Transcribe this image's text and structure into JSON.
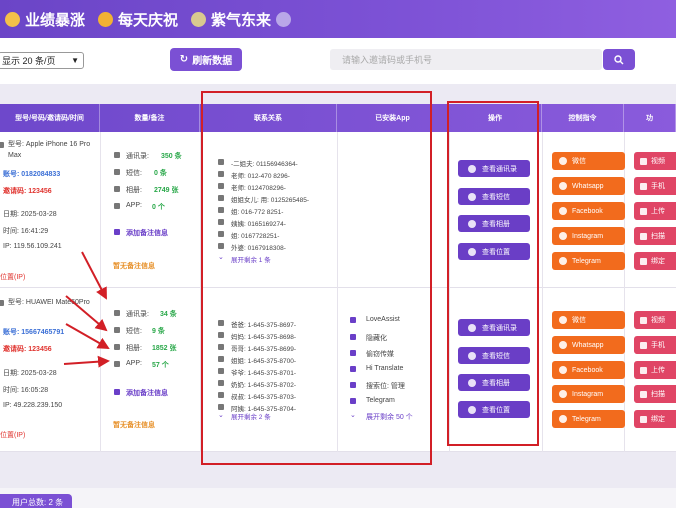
{
  "banner": {
    "seg1": "业绩暴涨",
    "seg2": "每天庆祝",
    "seg3": "紫气东来"
  },
  "toolbar": {
    "page_size": "显示 20 条/页",
    "refresh_label": "刷新数据",
    "search_placeholder": "请输入邀请码或手机号"
  },
  "columns": [
    "型号/号码/邀请码/时间",
    "数量/备注",
    "联系关系",
    "已安装App",
    "操作",
    "控制指令",
    "功"
  ],
  "rows": [
    {
      "model_label": "型号: Apple iPhone 16 Pro Max",
      "account": "账号: 0182084833",
      "invite": "邀请码: 123456",
      "date": "日期: 2025-03-28",
      "time": "时间: 16:41:29",
      "ip": "IP: 119.56.109.241",
      "loc": "位置(IP)",
      "stats": [
        {
          "label": "通讯录:",
          "value": "350 条"
        },
        {
          "label": "短信:",
          "value": "0 条"
        },
        {
          "label": "相册:",
          "value": "2749 张"
        },
        {
          "label": "APP:",
          "value": "0 个"
        }
      ],
      "add_note": "添加备注信息",
      "no_note": "暂无备注信息",
      "contacts": [
        "-二姐夫: 01156946364-",
        "老师: 012-470 8296-",
        "老师: 0124708296-",
        "姐姐女儿: 用: 0125265485-",
        "姐: 016-772 8251-",
        "姨姨: 0165169274-",
        "姐: 0167728251-",
        "外婆: 0167918308-"
      ],
      "contacts_more": "展开剩余 1 条",
      "apps": [],
      "apps_more": ""
    },
    {
      "model_label": "型号: HUAWEI Mate60Pro",
      "account": "账号: 15667465791",
      "invite": "邀请码: 123456",
      "date": "日期: 2025-03-28",
      "time": "时间: 16:05:28",
      "ip": "IP: 49.228.239.150",
      "loc": "位置(IP)",
      "stats": [
        {
          "label": "通讯录:",
          "value": "34 条"
        },
        {
          "label": "短信:",
          "value": "9 条"
        },
        {
          "label": "相册:",
          "value": "1852 张"
        },
        {
          "label": "APP:",
          "value": "57 个"
        }
      ],
      "add_note": "添加备注信息",
      "no_note": "暂无备注信息",
      "contacts": [
        "爸爸: 1-645-375-8697-",
        "妈妈: 1-645-375-8698-",
        "哥哥: 1-645-375-8699-",
        "姐姐: 1-645-375-8700-",
        "爷爷: 1-645-375-8701-",
        "奶奶: 1-645-375-8702-",
        "叔叔: 1-645-375-8703-",
        "阿姨: 1-645-375-8704-"
      ],
      "contacts_more": "展开剩余 2 条",
      "apps": [
        "LoveAssist",
        "隐藏化",
        "偷窃传媒",
        "Hi Translate",
        "搜索位: 管理",
        "Telegram"
      ],
      "apps_more": "展开剩余 50 个"
    }
  ],
  "operations": [
    "查看通讯录",
    "查看短信",
    "查看相册",
    "查看位置"
  ],
  "controls": [
    "微信",
    "Whatsapp",
    "Facebook",
    "Instagram",
    "Telegram"
  ],
  "functions": [
    "视频",
    "手机",
    "上传",
    "扫描",
    "绑定"
  ],
  "footer": {
    "user_count": "用户总数: 2 条"
  },
  "colors": {
    "primary": "#7b50d4",
    "control": "#f26b1d",
    "function": "#e04565",
    "annotation": "#d21f26"
  }
}
